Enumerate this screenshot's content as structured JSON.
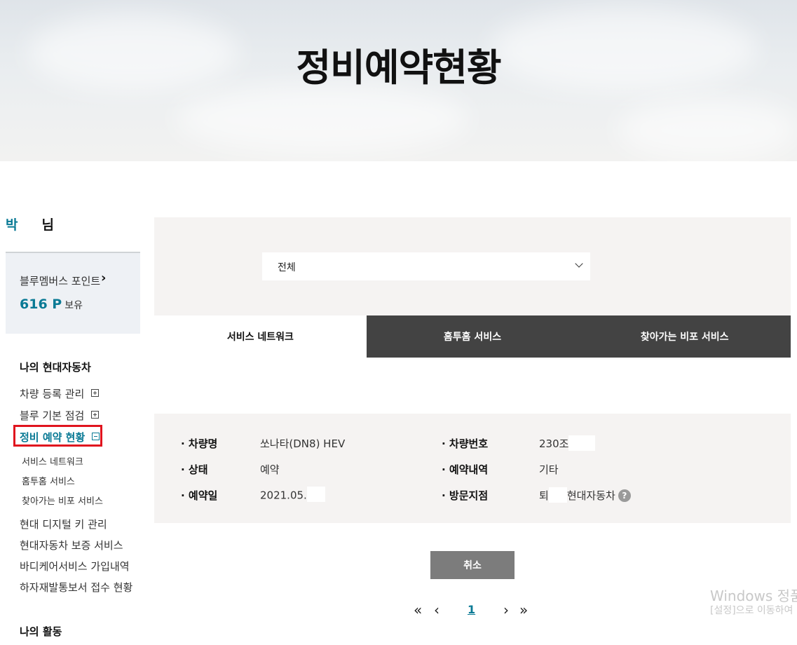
{
  "hero": {
    "title": "정비예약현황"
  },
  "user": {
    "first": "박",
    "suffix": "님"
  },
  "points": {
    "label": "블루멤버스 포인트",
    "value": "616 P",
    "unit": "보유"
  },
  "menu": {
    "section1": "나의 현대자동차",
    "items": [
      "차량 등록 관리",
      "블루 기본 점검"
    ],
    "active": "정비 예약 현황",
    "subs": [
      "서비스 네트워크",
      "홈투홈 서비스",
      "찾아가는 비포 서비스"
    ],
    "more": [
      "현대 디지털 키 관리",
      "현대자동차 보증 서비스",
      "바디케어서비스 가입내역",
      "하자재발통보서 접수 현황"
    ],
    "section2": "나의 활동"
  },
  "filter": {
    "selected": "전체"
  },
  "tabs": [
    "서비스 네트워크",
    "홈투홈 서비스",
    "찾아가는 비포 서비스"
  ],
  "detail": {
    "car_name_label": "· 차량명",
    "car_name": "쏘나타(DN8) HEV",
    "car_no_label": "· 차량번호",
    "car_no": "230조",
    "status_label": "· 상태",
    "status": "예약",
    "history_label": "· 예약내역",
    "history": "기타",
    "date_label": "· 예약일",
    "date": "2021.05.",
    "branch_label": "· 방문지점",
    "branch_a": "퇴",
    "branch_b": "현대자동차"
  },
  "cancel_label": "취소",
  "pagination": {
    "first": "«",
    "prev": "‹",
    "current": "1",
    "next": "›",
    "last": "»"
  },
  "watermark": {
    "line1": "Windows 정품",
    "line2": "[설정]으로 이동하여"
  },
  "icons": [
    "chevron-right-icon",
    "chevron-down-icon",
    "plus-box-icon",
    "minus-box-icon",
    "help-icon"
  ]
}
